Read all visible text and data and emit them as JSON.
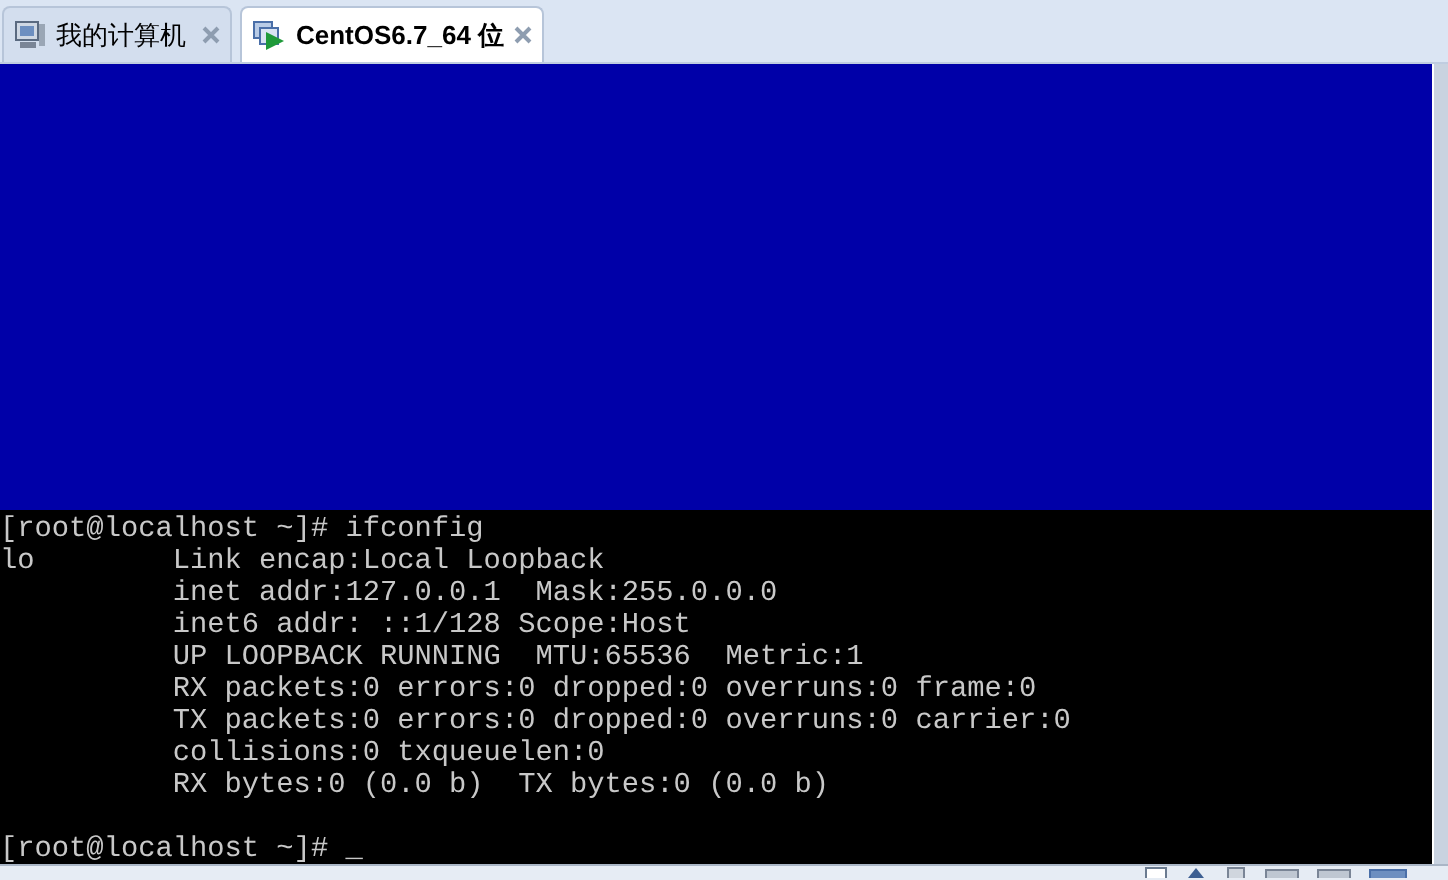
{
  "tabs": [
    {
      "label": "我的计算机",
      "kind": "computer",
      "selected": false
    },
    {
      "label": "CentOS6.7_64 位",
      "kind": "vm",
      "selected": true
    }
  ],
  "terminal": {
    "lines": [
      "[root@localhost ~]# ifconfig",
      "lo        Link encap:Local Loopback",
      "          inet addr:127.0.0.1  Mask:255.0.0.0",
      "          inet6 addr: ::1/128 Scope:Host",
      "          UP LOOPBACK RUNNING  MTU:65536  Metric:1",
      "          RX packets:0 errors:0 dropped:0 overruns:0 frame:0",
      "          TX packets:0 errors:0 dropped:0 overruns:0 carrier:0",
      "          collisions:0 txqueuelen:0",
      "          RX bytes:0 (0.0 b)  TX bytes:0 (0.0 b)"
    ],
    "prompt": "[root@localhost ~]# _"
  }
}
